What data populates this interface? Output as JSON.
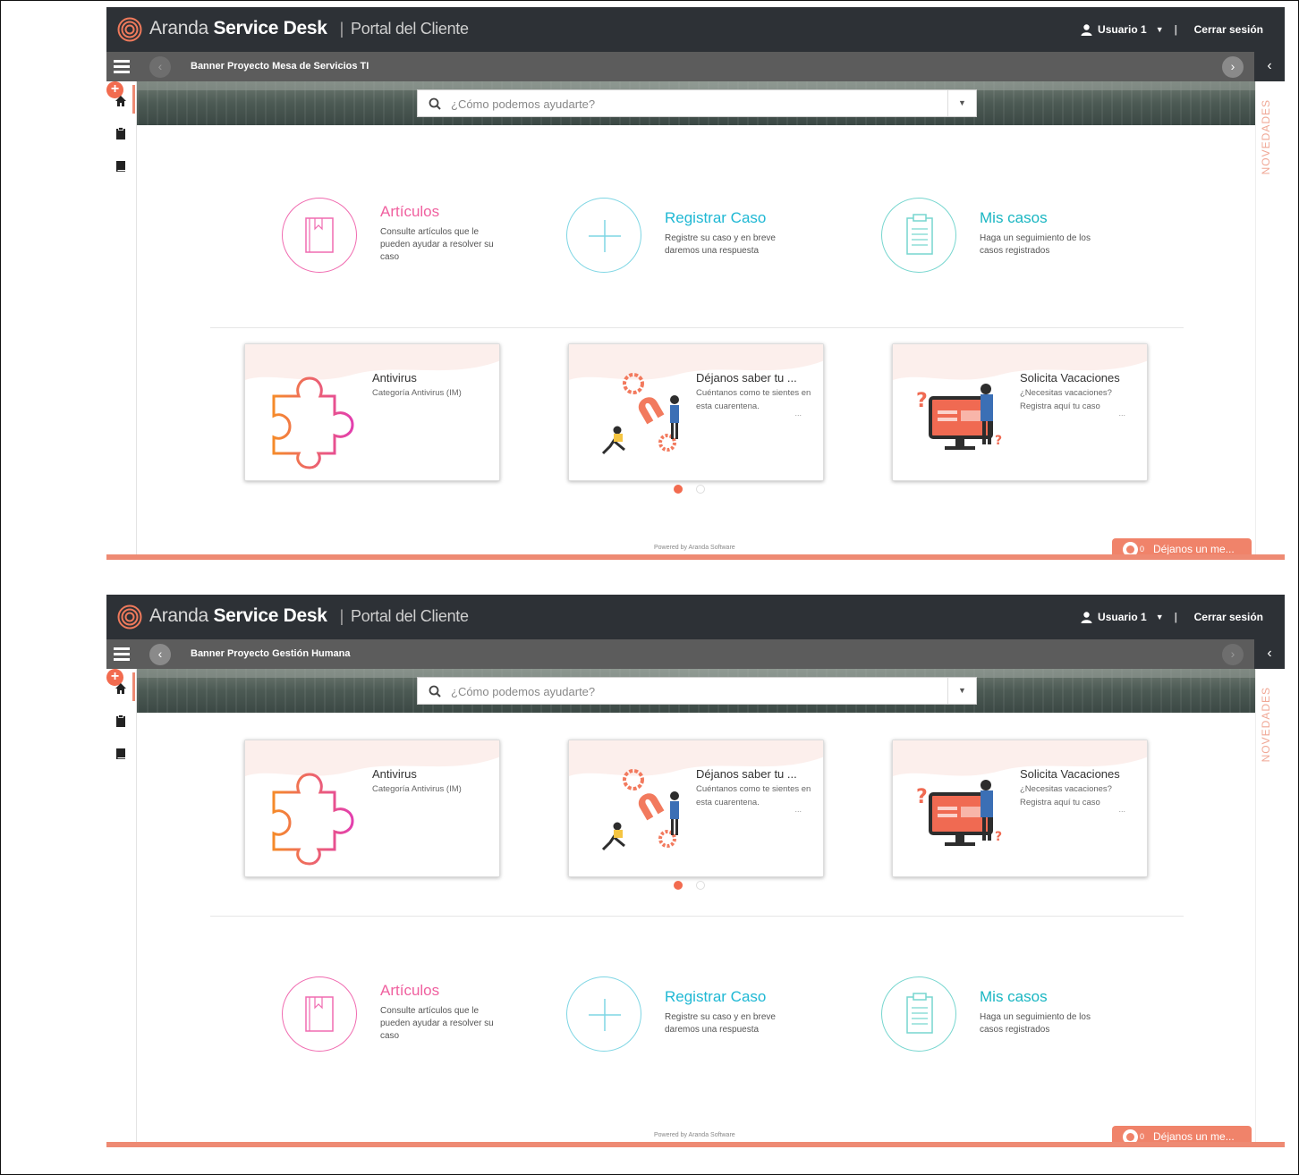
{
  "app": {
    "brand_part1": "Aranda",
    "brand_part2": "Service Desk",
    "separator": "|",
    "portal": "Portal del Cliente",
    "user": "Usuario 1",
    "logout": "Cerrar sesión",
    "novedades": "NOVEDADES",
    "powered": "Powered by Aranda Software",
    "chat_label": "Déjanos un me...",
    "chat_badge": "0",
    "search_placeholder": "¿Cómo podemos ayudarte?"
  },
  "actions": [
    {
      "title": "Artículos",
      "desc": "Consulte artículos que le pueden ayudar a resolver su caso",
      "icon": "book-icon"
    },
    {
      "title": "Registrar Caso",
      "desc": "Registre su caso y en breve daremos una respuesta",
      "icon": "plus-icon"
    },
    {
      "title": "Mis casos",
      "desc": "Haga un seguimiento de los casos registrados",
      "icon": "clipboard-icon"
    }
  ],
  "cards": [
    {
      "title": "Antivirus",
      "desc": "Categoría Antivirus (IM)",
      "more": "",
      "icon": "puzzle-icon"
    },
    {
      "title": "Déjanos saber tu ...",
      "desc": "Cuéntanos como te sientes en esta cuarentena.",
      "more": "...",
      "icon": "magnet-gears-illustration"
    },
    {
      "title": "Solicita Vacaciones",
      "desc": "¿Necesitas vacaciones? Registra aquí tu caso",
      "more": "...",
      "icon": "monitor-person-illustration"
    }
  ],
  "screens": [
    {
      "banner_title": "Banner Proyecto Mesa de Servicios TI"
    },
    {
      "banner_title": "Banner Proyecto Gestión Humana"
    }
  ],
  "colors": {
    "topbar": "#2d3136",
    "accent": "#ee8a73",
    "articulos": "#f0609f",
    "registrar": "#1fb8d4",
    "mis_casos": "#1ab6c2"
  }
}
